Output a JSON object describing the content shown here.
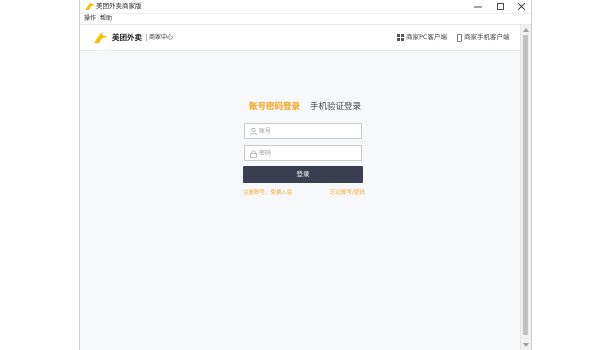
{
  "window": {
    "title": "美团外卖商家版",
    "controls": {
      "minimize": "minimize-icon",
      "maximize": "maximize-icon",
      "close": "close-icon"
    }
  },
  "menu": [
    "操作",
    "帮助"
  ],
  "header": {
    "brand": "美团外卖",
    "subtitle": "商家中心",
    "pc_client": "商家PC客户端",
    "mobile_client": "商家手机客户端"
  },
  "login": {
    "tab_password": "账号密码登录",
    "tab_sms": "手机验证登录",
    "account_placeholder": "账号",
    "password_placeholder": "密码",
    "submit": "登录",
    "register": "注册账号、免费入驻",
    "forgot": "忘记账号/密码"
  },
  "colors": {
    "accent": "#f6a623",
    "button": "#3c3f52"
  },
  "icons": [
    "app-icon",
    "kangaroo-logo",
    "windows-icon",
    "phone-icon",
    "user-icon",
    "lock-icon"
  ]
}
